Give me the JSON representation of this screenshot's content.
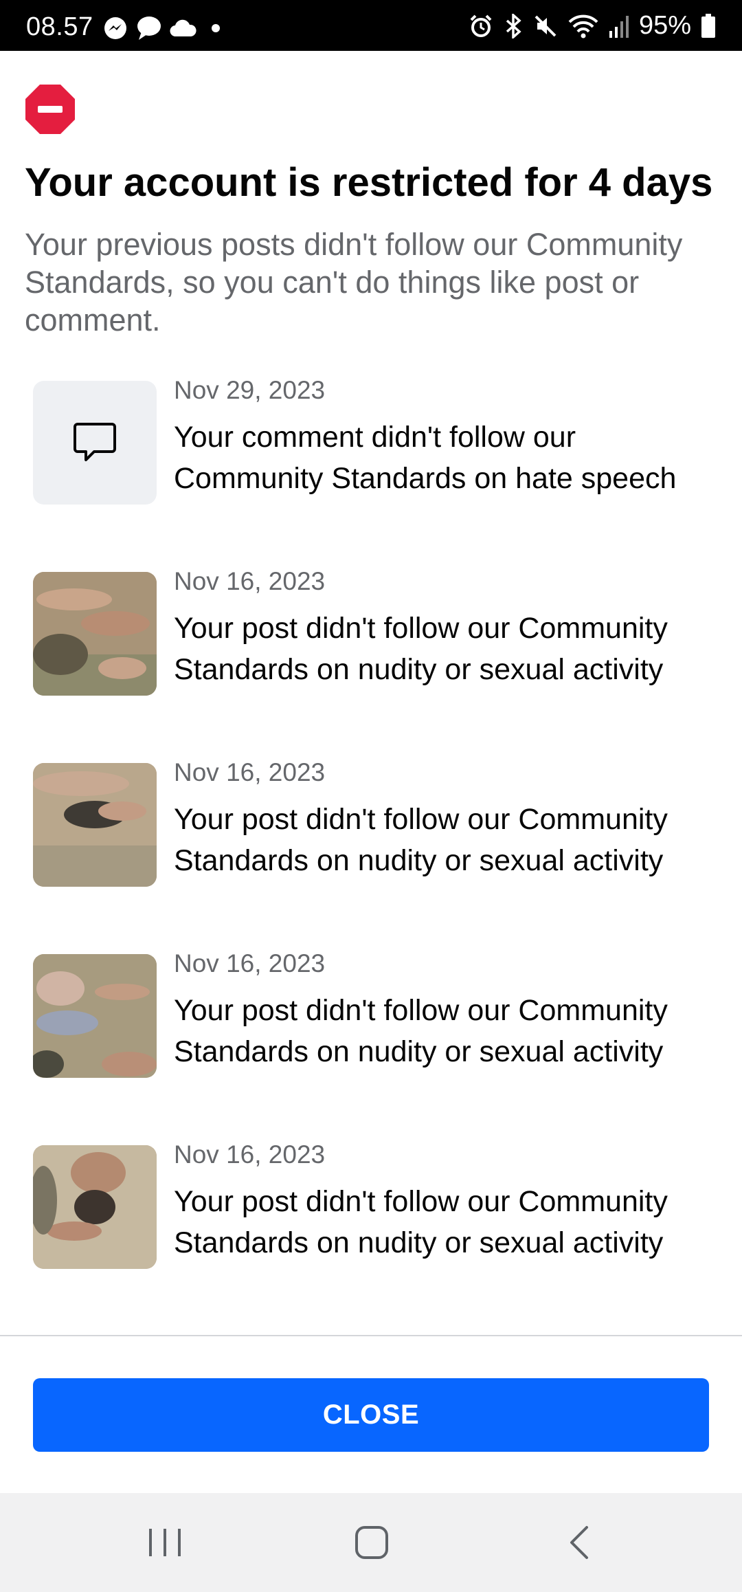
{
  "status_bar": {
    "time": "08.57",
    "battery": "95%",
    "left_icons": [
      "messenger-icon",
      "chat-icon",
      "cloud-icon",
      "dot-icon"
    ],
    "right_icons": [
      "alarm-icon",
      "bluetooth-icon",
      "mute-icon",
      "wifi-icon",
      "signal-icon",
      "battery-icon"
    ]
  },
  "dialog": {
    "title": "Your account is restricted for 4 days",
    "subtitle": "Your previous posts didn't follow our Community Standards, so you can't do things like post or comment."
  },
  "items": [
    {
      "date": "Nov 29, 2023",
      "description": "Your comment didn't follow our Community Standards on hate speech",
      "thumb": "comment-icon"
    },
    {
      "date": "Nov 16, 2023",
      "description": "Your post didn't follow our Community Standards on nudity or sexual activity",
      "thumb": "photo"
    },
    {
      "date": "Nov 16, 2023",
      "description": "Your post didn't follow our Community Standards on nudity or sexual activity",
      "thumb": "photo"
    },
    {
      "date": "Nov 16, 2023",
      "description": "Your post didn't follow our Community Standards on nudity or sexual activity",
      "thumb": "photo"
    },
    {
      "date": "Nov 16, 2023",
      "description": "Your post didn't follow our Community Standards on nudity or sexual activity",
      "thumb": "photo"
    }
  ],
  "close_button": {
    "label": "CLOSE"
  },
  "nav_bar": {
    "icons": [
      "recents-icon",
      "home-icon",
      "back-icon"
    ]
  },
  "colors": {
    "accent": "#0866ff",
    "alert": "#e41e3f",
    "secondary_text": "#65676b",
    "status_bar": "#000000"
  }
}
